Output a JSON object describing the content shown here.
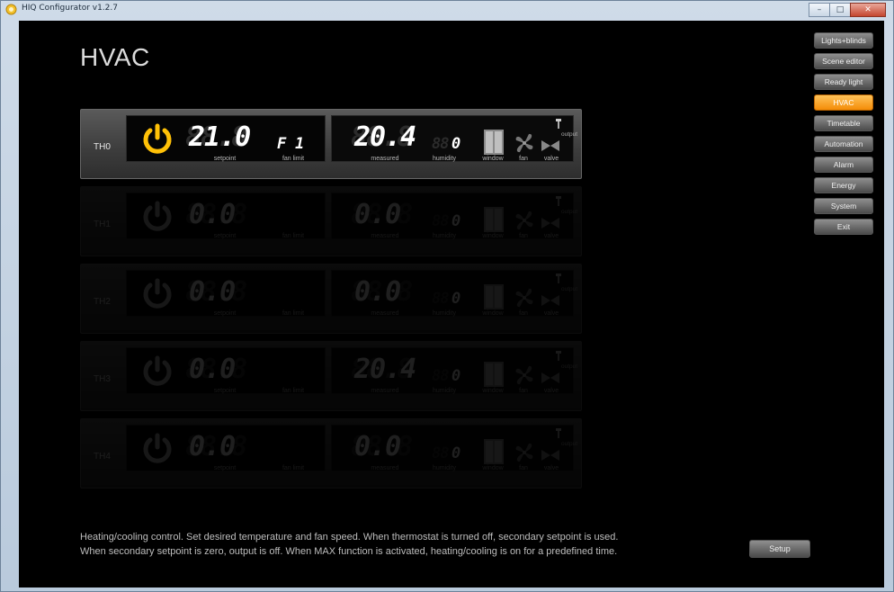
{
  "window": {
    "title": "HIQ Configurator v1.2.7",
    "buttons": {
      "minimize": "–",
      "maximize": "□",
      "close": "✕"
    }
  },
  "page": {
    "title": "HVAC"
  },
  "nav": {
    "items": [
      {
        "label": "Lights+blinds",
        "active": false
      },
      {
        "label": "Scene editor",
        "active": false
      },
      {
        "label": "Ready light",
        "active": false
      },
      {
        "label": "HVAC",
        "active": true
      },
      {
        "label": "Timetable",
        "active": false
      },
      {
        "label": "Automation",
        "active": false
      },
      {
        "label": "Alarm",
        "active": false
      },
      {
        "label": "Energy",
        "active": false
      },
      {
        "label": "System",
        "active": false
      },
      {
        "label": "Exit",
        "active": false
      }
    ]
  },
  "captions": {
    "setpoint": "setpoint",
    "fan_limit": "fan limit",
    "measured": "measured",
    "humidity": "humidity",
    "window": "window",
    "fan": "fan",
    "valve": "valve",
    "output": "output"
  },
  "thermostats": [
    {
      "label": "TH0",
      "setpoint": "21.0",
      "fan_limit_prefix": "F",
      "fan_limit": "1",
      "measured": "20.4",
      "humidity": "0",
      "power_on": true,
      "dim": false
    },
    {
      "label": "TH1",
      "setpoint": "0.0",
      "fan_limit_prefix": "",
      "fan_limit": "",
      "measured": "0.0",
      "humidity": "0",
      "power_on": false,
      "dim": true
    },
    {
      "label": "TH2",
      "setpoint": "0.0",
      "fan_limit_prefix": "",
      "fan_limit": "",
      "measured": "0.0",
      "humidity": "0",
      "power_on": false,
      "dim": true
    },
    {
      "label": "TH3",
      "setpoint": "0.0",
      "fan_limit_prefix": "",
      "fan_limit": "",
      "measured": "20.4",
      "humidity": "0",
      "power_on": false,
      "dim": true
    },
    {
      "label": "TH4",
      "setpoint": "0.0",
      "fan_limit_prefix": "",
      "fan_limit": "",
      "measured": "0.0",
      "humidity": "0",
      "power_on": false,
      "dim": true
    }
  ],
  "hint": {
    "line1": "Heating/cooling control. Set desired temperature and fan speed. When thermostat is turned off, secondary setpoint is used.",
    "line2": "When secondary setpoint is zero, output is off. When MAX function is activated, heating/cooling is on for a predefined time."
  },
  "setup_button": "Setup",
  "colors": {
    "accent": "#f7a21b",
    "power_on": "#ffc107",
    "background": "#000000"
  }
}
